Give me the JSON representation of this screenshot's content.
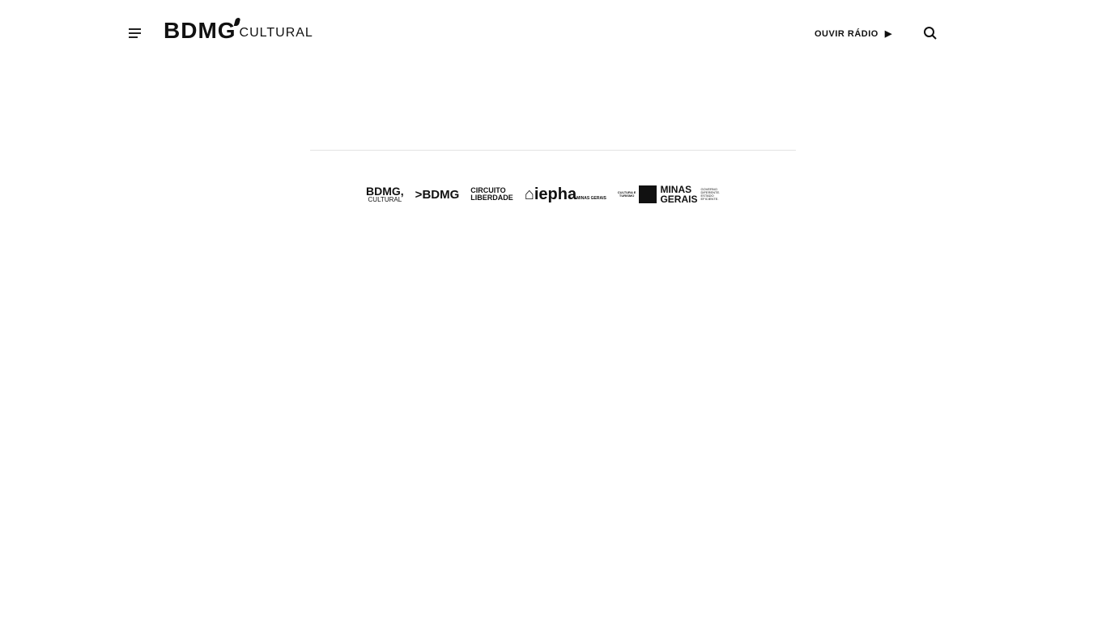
{
  "header": {
    "logo_main": "BDMG",
    "logo_sub": "CULTURAL",
    "radio_label": "OUVIR RÁDIO",
    "radio_icon": "play-icon"
  },
  "partners": {
    "bdmg_cultural": {
      "main": "BDMG,",
      "sub": "CULTURAL"
    },
    "bdmg": "BDMG",
    "circuito": [
      "CIRCUITO",
      "LIBERDADE"
    ],
    "iepha": {
      "main": "iepha",
      "sub": "MINAS GERAIS"
    },
    "secretaria": [
      "CULTURA E",
      "TURISMO"
    ],
    "minas": [
      "MINAS",
      "GERAIS"
    ],
    "governo": [
      "GOVERNO",
      "DIFERENTE.",
      "ESTADO",
      "EFICIENTE."
    ]
  }
}
